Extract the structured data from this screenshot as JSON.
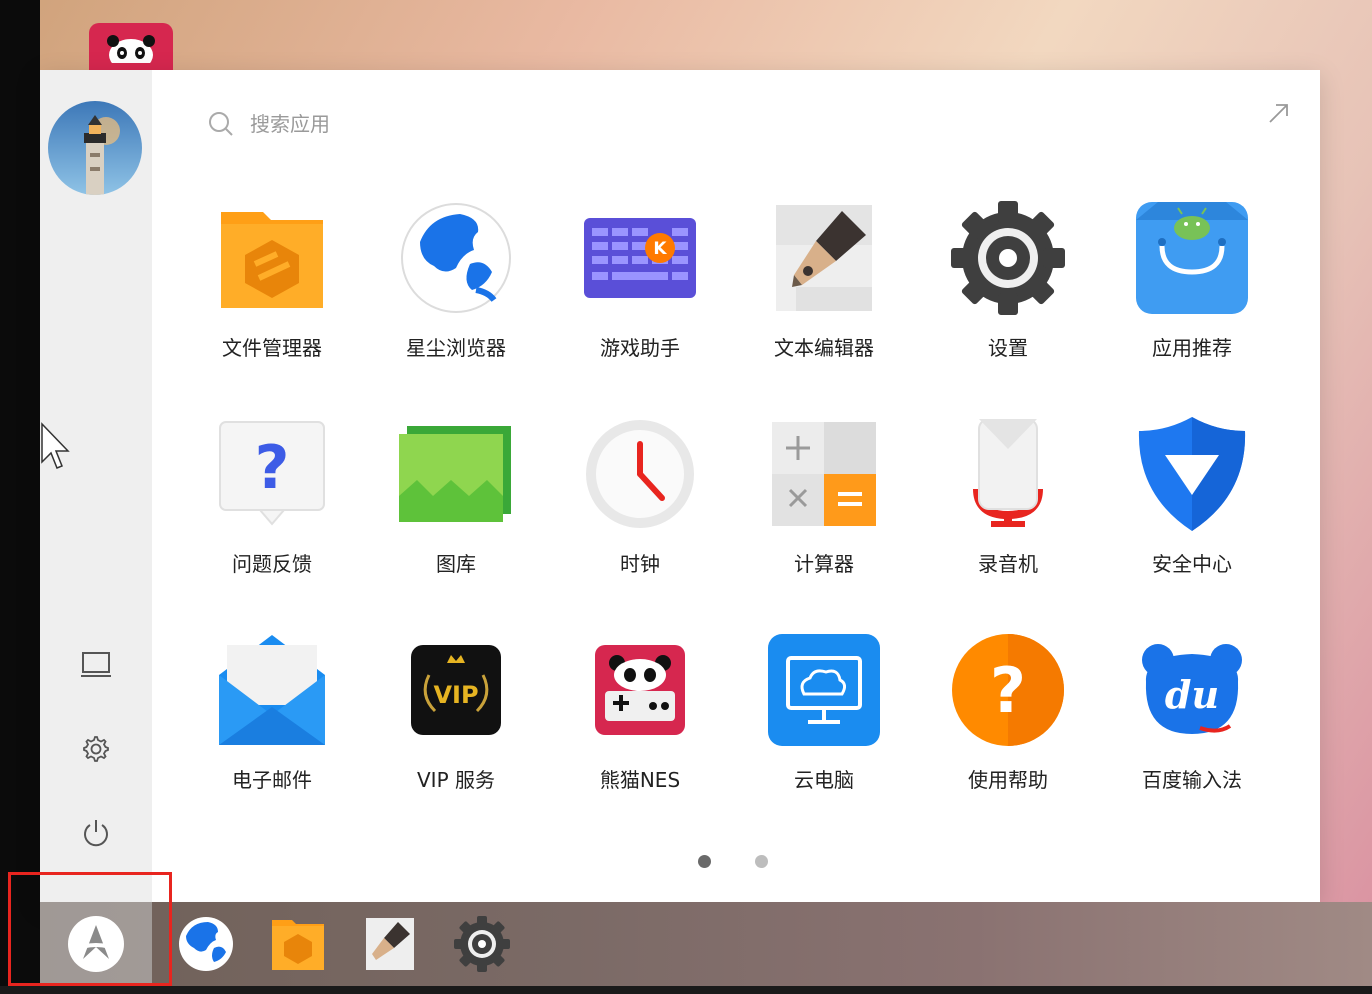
{
  "search": {
    "placeholder": "搜索应用"
  },
  "apps": [
    {
      "label": "文件管理器",
      "icon": "folder-icon"
    },
    {
      "label": "星尘浏览器",
      "icon": "globe-browser-icon"
    },
    {
      "label": "游戏助手",
      "icon": "keyboard-game-icon"
    },
    {
      "label": "文本编辑器",
      "icon": "pen-editor-icon"
    },
    {
      "label": "设置",
      "icon": "gear-settings-icon"
    },
    {
      "label": "应用推荐",
      "icon": "shopping-bag-icon"
    },
    {
      "label": "问题反馈",
      "icon": "question-bubble-icon"
    },
    {
      "label": "图库",
      "icon": "gallery-icon"
    },
    {
      "label": "时钟",
      "icon": "clock-icon"
    },
    {
      "label": "计算器",
      "icon": "calculator-icon"
    },
    {
      "label": "录音机",
      "icon": "recorder-icon"
    },
    {
      "label": "安全中心",
      "icon": "shield-icon"
    },
    {
      "label": "电子邮件",
      "icon": "mail-icon"
    },
    {
      "label": "VIP 服务",
      "icon": "vip-icon"
    },
    {
      "label": "熊猫NES",
      "icon": "panda-nes-icon"
    },
    {
      "label": "云电脑",
      "icon": "cloud-computer-icon"
    },
    {
      "label": "使用帮助",
      "icon": "help-icon"
    },
    {
      "label": "百度输入法",
      "icon": "baidu-input-icon"
    }
  ],
  "pagination": {
    "current": 1,
    "total": 2
  },
  "colors": {
    "folder": "#ffa41b",
    "blue": "#1a8cf0",
    "purple": "#5a54e0",
    "orange": "#ff8a00",
    "red": "#e8251f",
    "green": "#5ec23a"
  }
}
